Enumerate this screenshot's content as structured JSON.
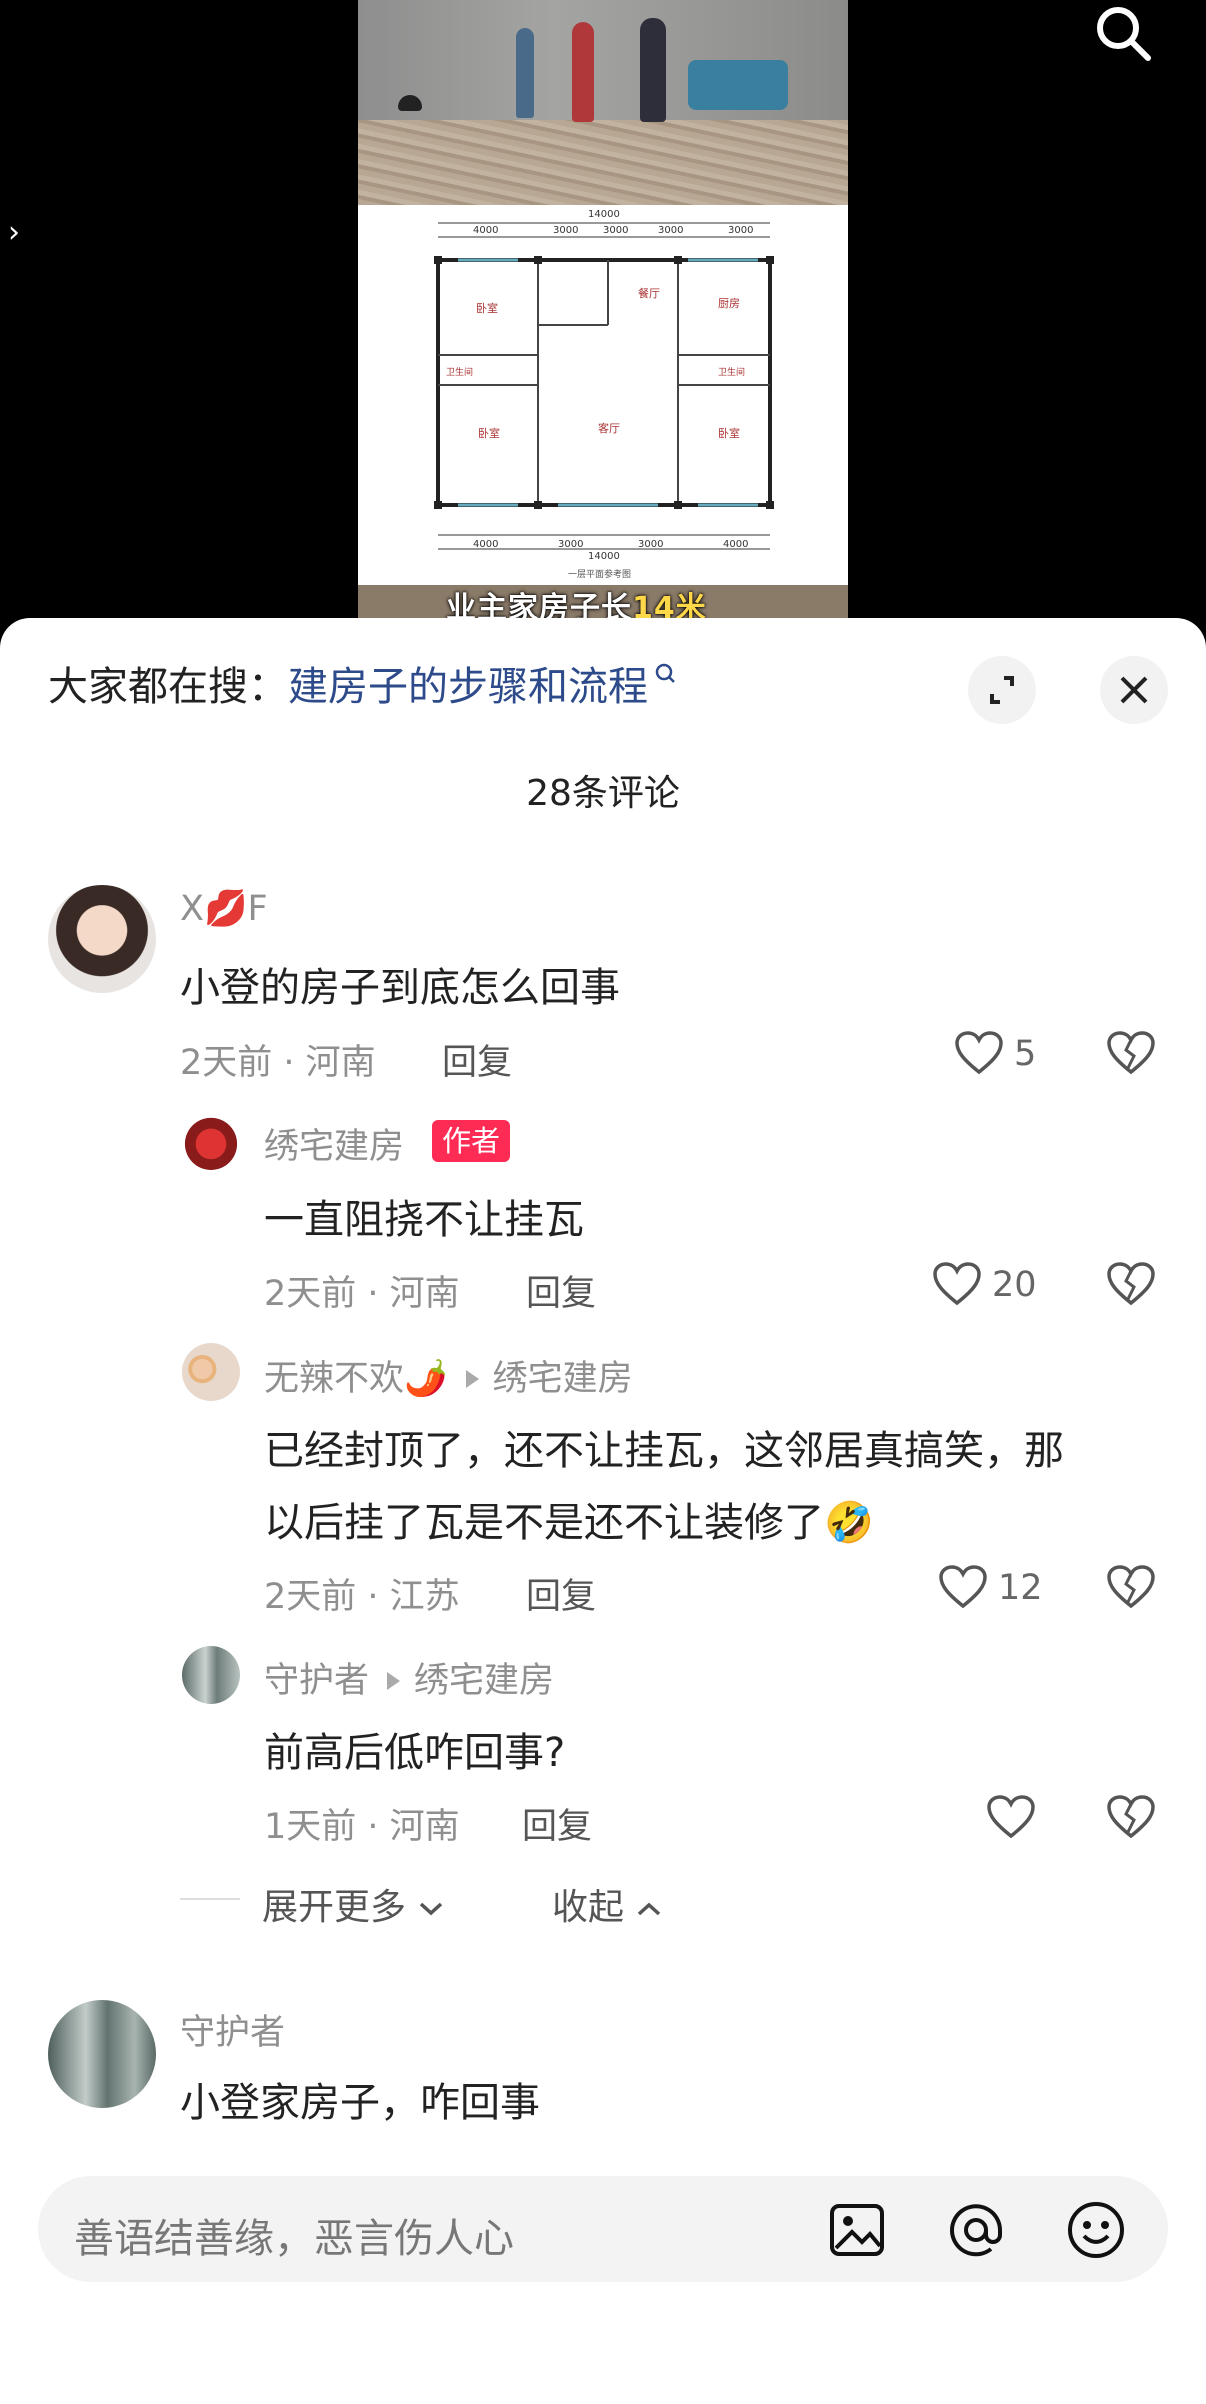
{
  "video": {
    "subtitle_prefix": "业主家房子长",
    "subtitle_highlight": "14米",
    "floorplan": {
      "total_width": "14000",
      "top_dims": [
        "4000",
        "3000",
        "3000",
        "3000",
        "3000"
      ],
      "bottom_dims": [
        "4000",
        "3000",
        "3000",
        "4000"
      ],
      "rooms": [
        "卧室",
        "餐厅",
        "厨房",
        "卫生间",
        "卫生间",
        "卧室",
        "客厅",
        "卧室"
      ],
      "caption": "一层平面参考图"
    }
  },
  "search": {
    "prefix": "大家都在搜：",
    "term": "建房子的步骤和流程"
  },
  "comment_count": "28条评论",
  "comments": [
    {
      "user": "X💋F",
      "text": "小登的房子到底怎么回事",
      "time_loc": "2天前 · 河南",
      "reply": "回复",
      "likes": "5",
      "replies": [
        {
          "user": "绣宅建房",
          "badge": "作者",
          "text": "一直阻挠不让挂瓦",
          "time_loc": "2天前 · 河南",
          "reply": "回复",
          "likes": "20"
        },
        {
          "user": "无辣不欢🌶️",
          "reply_to": "绣宅建房",
          "text_line1": "已经封顶了，还不让挂瓦，这邻居真搞笑，那",
          "text_line2": "以后挂了瓦是不是还不让装修了",
          "emoji": "🤣",
          "time_loc": "2天前 · 江苏",
          "reply": "回复",
          "likes": "12"
        },
        {
          "user": "守护者",
          "reply_to": "绣宅建房",
          "text": "前高后低咋回事?",
          "time_loc": "1天前 · 河南",
          "reply": "回复",
          "likes": ""
        }
      ],
      "expand_more": "展开更多",
      "collapse": "收起"
    },
    {
      "user": "守护者",
      "text": "小登家房子，咋回事"
    }
  ],
  "input": {
    "placeholder": "善语结善缘，恶言伤人心"
  },
  "colors": {
    "accent": "#fe2c55",
    "search_term": "#2d4a8a"
  }
}
